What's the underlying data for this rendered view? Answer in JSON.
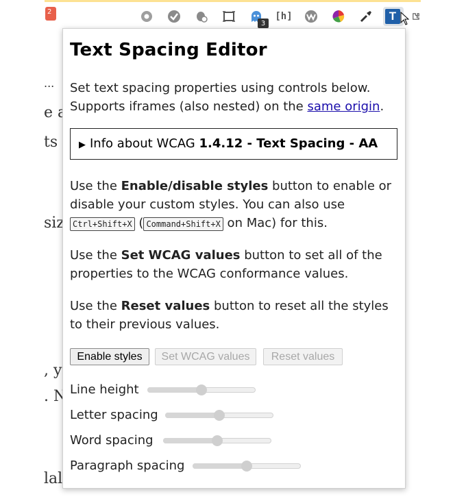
{
  "background": {
    "favicon_badge": "2",
    "fragments": [
      {
        "text": "..."
      },
      {
        "text": "e a"
      },
      {
        "text": "ts"
      },
      {
        "text": "siz"
      },
      {
        "text": ", y"
      },
      {
        "text": ". N"
      },
      {
        "text": "lal"
      }
    ]
  },
  "toolbar": {
    "icons": [
      "gear-extension-icon",
      "check-extension-icon",
      "bug-extension-icon",
      "screenshot-extension-icon",
      "ghost-extension-icon",
      "headings-extension-icon",
      "wave-extension-icon",
      "color-wheel-extension-icon",
      "eyedropper-extension-icon",
      "text-spacing-extension-icon",
      "puzzle-extension-icon"
    ],
    "badge": "3",
    "headings_label": "[h]",
    "text_spacing_label": "T"
  },
  "popup": {
    "title": "Text Spacing Editor",
    "intro_line1": "Set text spacing properties using controls below.",
    "intro_line2_prefix": "Supports iframes (also nested) on the ",
    "intro_link": "same origin",
    "intro_line2_suffix": ".",
    "details_prefix": "Info about WCAG ",
    "details_bold": "1.4.12 - Text Spacing - AA",
    "enable_para": {
      "prefix": "Use the ",
      "bold": "Enable/disable styles",
      "middle": " button to enable or disable your custom styles. You can also use ",
      "kbd1": "Ctrl+Shift+X",
      "paren_open": " (",
      "kbd2": "Command+Shift+X",
      "suffix": " on Mac) for this."
    },
    "wcag_para": {
      "prefix": "Use the ",
      "bold": "Set WCAG values",
      "suffix": " button to set all of the properties to the WCAG conformance values."
    },
    "reset_para": {
      "prefix": "Use the ",
      "bold": "Reset values",
      "suffix": " button to reset all the styles to their previous values."
    },
    "buttons": {
      "enable": "Enable styles",
      "set_wcag": "Set WCAG values",
      "reset": "Reset values"
    },
    "sliders": [
      {
        "label": "Line height",
        "value": 0.5
      },
      {
        "label": "Letter spacing",
        "value": 0.5
      },
      {
        "label": "Word spacing",
        "value": 0.5
      },
      {
        "label": "Paragraph spacing",
        "value": 0.5
      }
    ]
  }
}
